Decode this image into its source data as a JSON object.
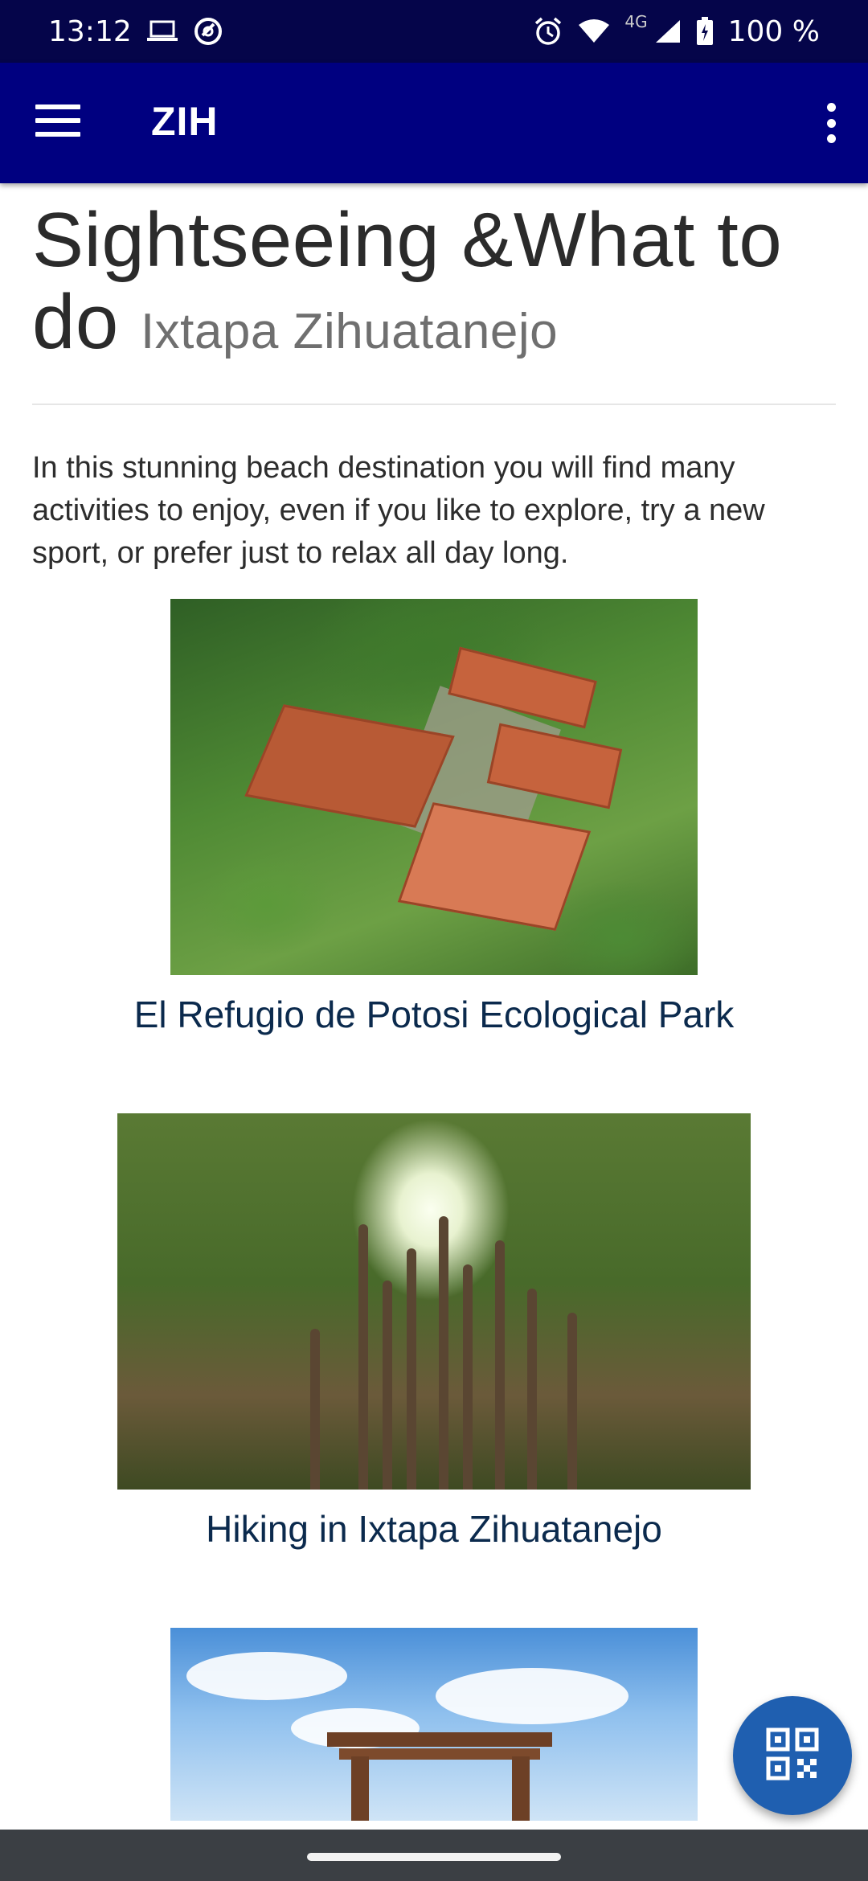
{
  "status_bar": {
    "time": "13:12",
    "network": "4G",
    "battery": "100 %",
    "icons": [
      "laptop-icon",
      "sync-icon",
      "alarm-icon",
      "wifi-icon",
      "signal-icon",
      "battery-icon"
    ]
  },
  "app_bar": {
    "title": "ZIH",
    "menu_icon": "hamburger-menu-icon",
    "more_icon": "more-vert-icon"
  },
  "page": {
    "title": "Sightseeing &What to do",
    "subtitle": "Ixtapa Zihuatanejo",
    "intro": "In this stunning beach destination you will find many activities to enjoy, even if  you like to explore, try a new sport, or prefer just to relax all day long."
  },
  "cards": [
    {
      "label": "El Refugio de Potosi Ecological Park"
    },
    {
      "label": "Hiking in Ixtapa Zihuatanejo"
    }
  ],
  "fab": {
    "icon": "qr-code-icon"
  },
  "colors": {
    "status_bar": "#05054a",
    "app_bar": "#000080",
    "fab": "#1f5fb0",
    "card_label": "#0b2a4d"
  }
}
